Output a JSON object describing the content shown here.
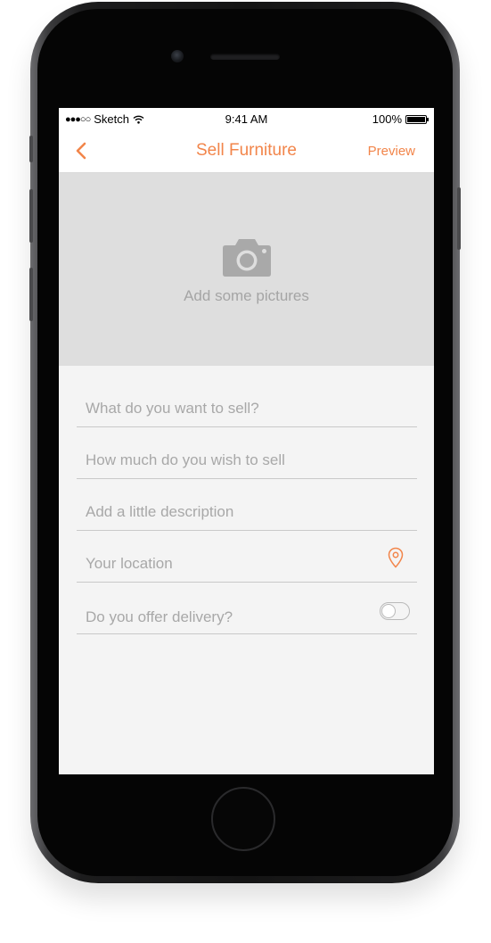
{
  "status_bar": {
    "carrier": "Sketch",
    "signal_dots": "●●●○○",
    "time": "9:41 AM",
    "battery": "100%",
    "icons": [
      "wifi-icon",
      "battery-icon"
    ]
  },
  "nav": {
    "back_icon": "chevron-left-icon",
    "title": "Sell Furniture",
    "preview_label": "Preview"
  },
  "photo": {
    "icon": "camera-icon",
    "label": "Add some pictures"
  },
  "form": {
    "title_placeholder": "What do you want to sell?",
    "price_placeholder": "How much do you wish to sell",
    "description_placeholder": "Add a little description",
    "location_placeholder": "Your location",
    "location_icon": "map-pin-icon",
    "delivery_label": "Do you offer delivery?",
    "delivery_enabled": false
  },
  "colors": {
    "accent": "#f2854a",
    "placeholder": "#a8a8a8",
    "photo_area": "#dedede",
    "background": "#f4f4f4"
  }
}
